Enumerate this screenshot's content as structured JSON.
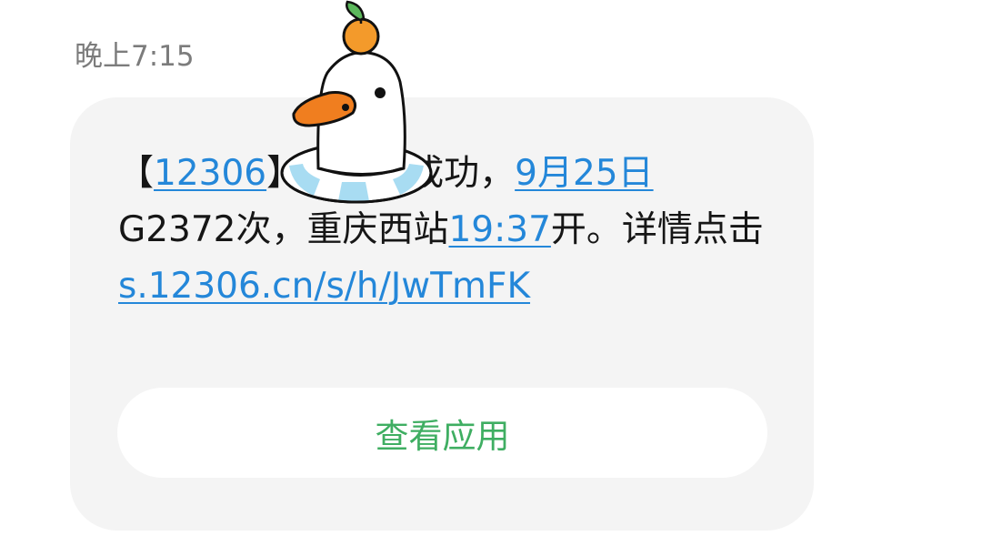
{
  "message": {
    "time": "晚上7:15",
    "text": {
      "bracket_open": "【",
      "sender_link": "12306",
      "bracket_close": "】",
      "body_part1": "您购票成功，",
      "date_link": "9月25日",
      "body_part2": "G2372次，重庆西站",
      "time_link": "19:37",
      "body_part3": "开。详情点击",
      "url_link": "s.12306.cn/s/h/JwTmFK"
    },
    "action_button": "查看应用"
  },
  "sticker": {
    "icon": "duck-with-orange-sticker",
    "colors": {
      "orange": "#f39a2b",
      "leaf": "#5cb85c",
      "beak": "#f07e1f",
      "float_ring": "#a8dcf2"
    }
  },
  "colors": {
    "link": "#2487d9",
    "button_text": "#3fae62",
    "bubble_bg": "#f4f4f4",
    "timestamp": "#7c7c7c"
  }
}
